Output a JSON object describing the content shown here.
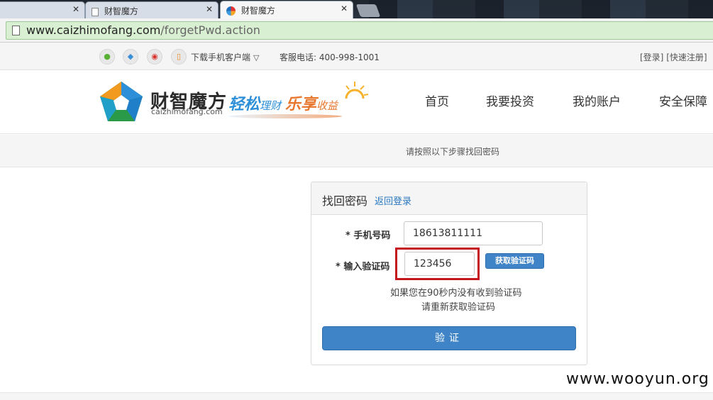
{
  "browser": {
    "tabs": [
      {
        "title": ""
      },
      {
        "title": "财智魔方"
      },
      {
        "title": "财智魔方"
      }
    ],
    "url_host": "www.caizhimofang.com",
    "url_path": "/forgetPwd.action"
  },
  "topbar": {
    "download_label": "下载手机客户端",
    "hotline": "客服电话: 400-998-1001",
    "login": "[登录]",
    "register": "[快速注册]"
  },
  "header": {
    "logo_cn": "财智魔方",
    "logo_en": "caizhimofang.com",
    "slogan": [
      "轻松",
      "理财",
      "乐享",
      "收益"
    ],
    "nav": [
      "首页",
      "我要投资",
      "我的账户",
      "安全保障"
    ]
  },
  "stepbar": {
    "text": "请按照以下步骤找回密码"
  },
  "panel": {
    "title": "找回密码",
    "back_link": "返回登录",
    "phone_label": "* 手机号码",
    "phone_value": "18613811111",
    "code_label": "* 输入验证码",
    "code_value": "123456",
    "get_code_label": "获取验证码",
    "hint_line1": "如果您在90秒内没有收到验证码",
    "hint_line2": "请重新获取验证码",
    "verify_label": "验证"
  },
  "watermark": "www.wooyun.org",
  "colors": {
    "accent_blue": "#3f84c7",
    "highlight_red": "#c5161d",
    "slogan_blue": "#2d8fd8",
    "slogan_orange": "#e8772e",
    "omnibox_green": "#d9efd2"
  }
}
